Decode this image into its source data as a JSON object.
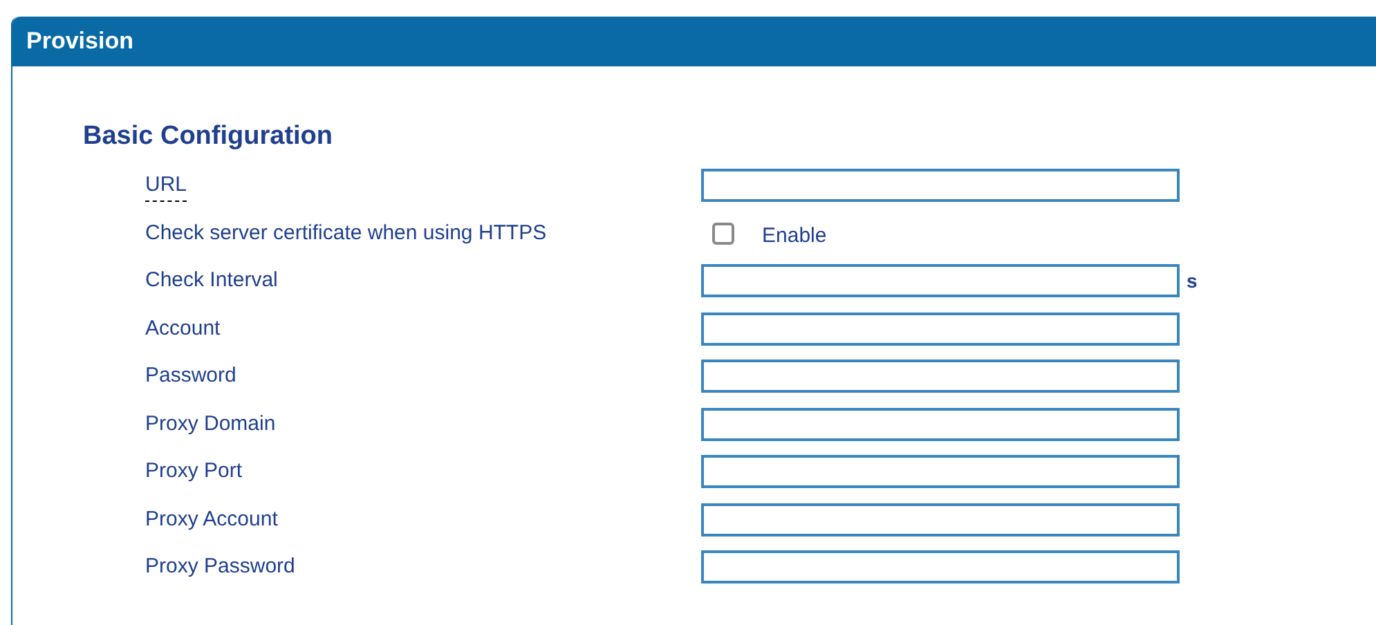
{
  "panel": {
    "title": "Provision"
  },
  "section": {
    "title": "Basic Configuration"
  },
  "rows": [
    {
      "kind": "text",
      "label": "URL",
      "hint_underline": true
    },
    {
      "kind": "checkbox",
      "label": "Check server certificate when using HTTPS",
      "checked": false,
      "option": "Enable"
    },
    {
      "kind": "text",
      "label": "Check Interval",
      "unit": "s"
    },
    {
      "kind": "text",
      "label": "Account"
    },
    {
      "kind": "text",
      "label": "Password"
    },
    {
      "kind": "text",
      "label": "Proxy Domain"
    },
    {
      "kind": "text",
      "label": "Proxy Port"
    },
    {
      "kind": "text",
      "label": "Proxy Account"
    },
    {
      "kind": "text",
      "label": "Proxy Password"
    }
  ]
}
